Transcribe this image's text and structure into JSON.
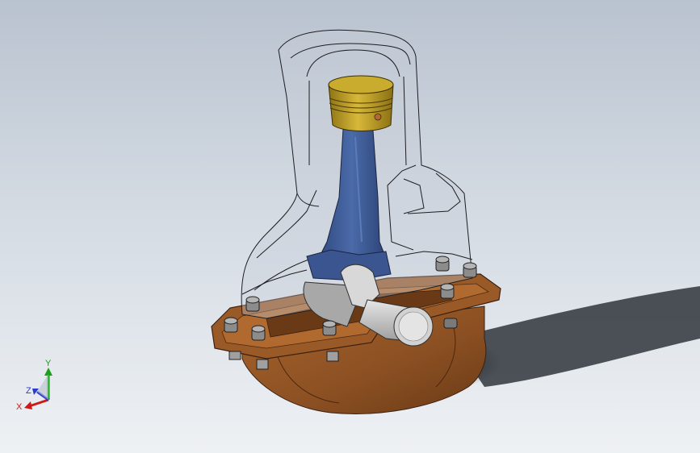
{
  "viewport": {
    "background_top": "#b9c3cf",
    "background_bottom": "#eef1f4"
  },
  "model": {
    "components": [
      {
        "name": "cylinder-housing",
        "style": "transparent-wireframe"
      },
      {
        "name": "piston",
        "color": "#b99a1e"
      },
      {
        "name": "connecting-rod",
        "color": "#3c5a94"
      },
      {
        "name": "crankshaft",
        "color": "#c8c8c8"
      },
      {
        "name": "crankcase-base",
        "color": "#8a4f22"
      },
      {
        "name": "mounting-bolts",
        "color": "#9a9a9a"
      }
    ]
  },
  "triad": {
    "x_label": "X",
    "y_label": "Y",
    "z_label": "Z",
    "x_color": "#d01818",
    "y_color": "#18a018",
    "z_color": "#2a3cc8"
  }
}
